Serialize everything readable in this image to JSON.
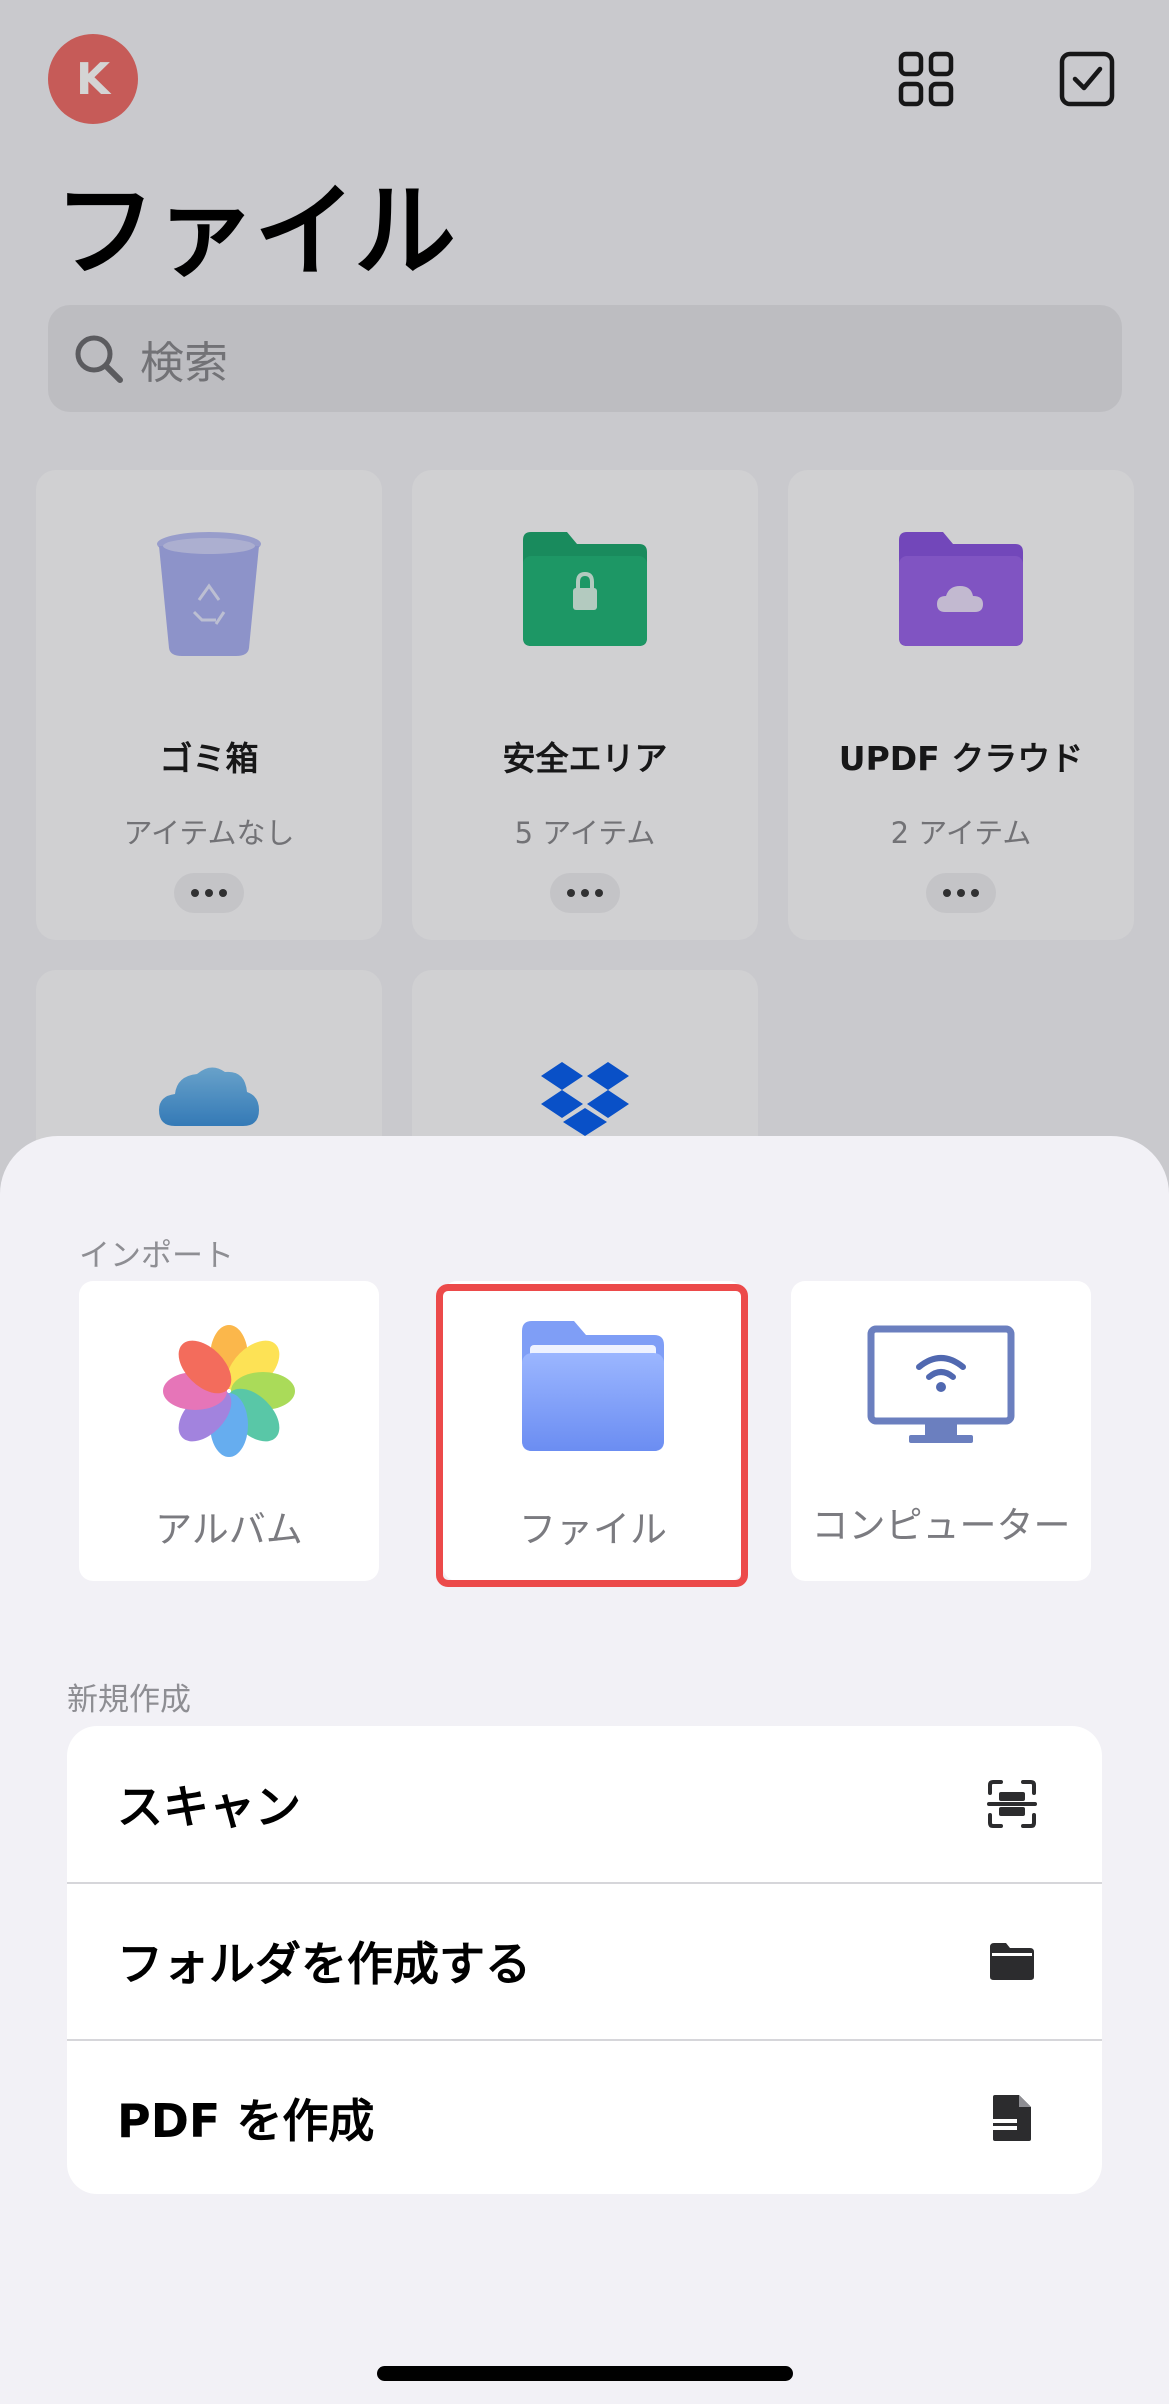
{
  "header": {
    "avatar_initial": "K",
    "title": "ファイル",
    "grid_icon": "grid-view-icon",
    "select_icon": "checkbox-select-icon"
  },
  "search": {
    "placeholder": "検索",
    "icon": "search-icon"
  },
  "cards": [
    {
      "name": "ゴミ箱",
      "count": "アイテムなし",
      "icon": "trash-icon",
      "color": "#a9b0f0"
    },
    {
      "name": "安全エリア",
      "count": "5 アイテム",
      "icon": "secure-folder-icon",
      "color": "#1fa870"
    },
    {
      "name": "UPDF クラウド",
      "count": "2 アイテム",
      "icon": "cloud-folder-icon",
      "color": "#8a56e0"
    },
    {
      "name": "",
      "count": "",
      "icon": "icloud-icon",
      "color": "#4aa5e8"
    },
    {
      "name": "",
      "count": "",
      "icon": "dropbox-icon",
      "color": "#0b61f0"
    }
  ],
  "sheet": {
    "import_label": "インポート",
    "import_items": [
      {
        "label": "アルバム",
        "icon": "photos-icon"
      },
      {
        "label": "ファイル",
        "icon": "files-folder-icon",
        "highlighted": true,
        "highlight_color": "#ec4a4a"
      },
      {
        "label": "コンピューター",
        "icon": "computer-wifi-icon"
      }
    ],
    "new_label": "新規作成",
    "new_items": [
      {
        "label": "スキャン",
        "icon": "scan-icon"
      },
      {
        "label": "フォルダを作成する",
        "icon": "folder-icon"
      },
      {
        "label": "PDF を作成",
        "icon": "pdf-document-icon"
      }
    ]
  }
}
